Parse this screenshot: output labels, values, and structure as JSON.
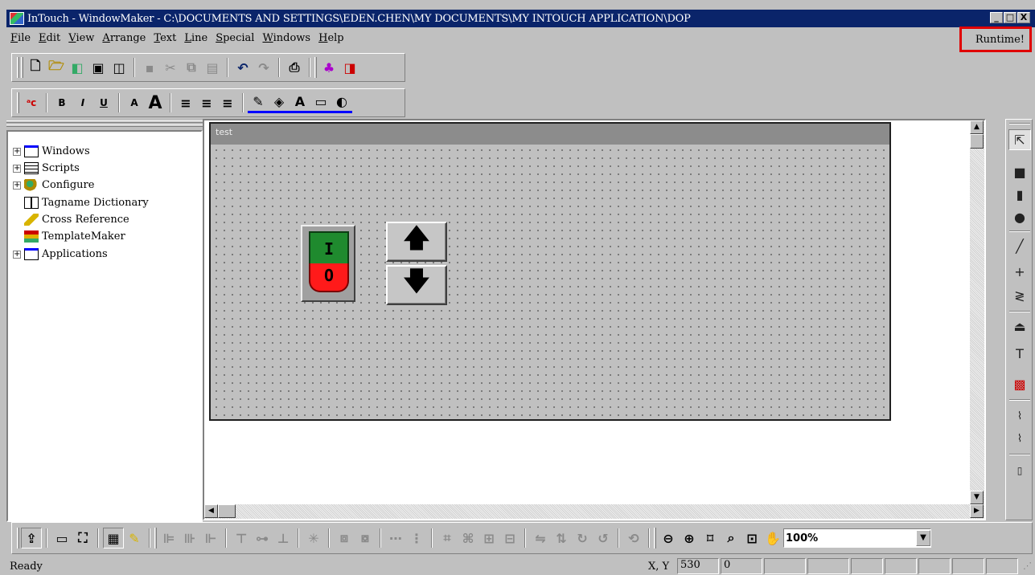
{
  "titlebar": {
    "title": "InTouch - WindowMaker - C:\\DOCUMENTS AND SETTINGS\\EDEN.CHEN\\MY DOCUMENTS\\MY INTOUCH APPLICATION\\DOP",
    "minimize": "_",
    "maximize": "□",
    "close": "X"
  },
  "menu": {
    "items": [
      "File",
      "Edit",
      "View",
      "Arrange",
      "Text",
      "Line",
      "Special",
      "Windows",
      "Help"
    ],
    "runtime": "Runtime!"
  },
  "tree": {
    "nodes": [
      {
        "label": "Windows",
        "expander": "+",
        "icon": "window-icon"
      },
      {
        "label": "Scripts",
        "expander": "+",
        "icon": "script-icon"
      },
      {
        "label": "Configure",
        "expander": "+",
        "icon": "configure-icon"
      },
      {
        "label": "Tagname Dictionary",
        "expander": "",
        "icon": "dictionary-icon"
      },
      {
        "label": "Cross Reference",
        "expander": "",
        "icon": "cross-reference-icon"
      },
      {
        "label": "TemplateMaker",
        "expander": "",
        "icon": "template-icon"
      },
      {
        "label": "Applications",
        "expander": "+",
        "icon": "applications-icon"
      }
    ]
  },
  "canvas": {
    "window_title": "test",
    "switch_on": "I",
    "switch_off": "O",
    "up_arrow": "🡅",
    "down_arrow": "🡇"
  },
  "bottom": {
    "zoom": "100%"
  },
  "status": {
    "text": "Ready",
    "xy_label": "X, Y",
    "x_value": "530",
    "y_value": "0"
  },
  "colors": {
    "title_bar": "#0a246a",
    "highlight": "#e00000",
    "switch_on": "#1f8a2e",
    "switch_off": "#ff1a1a"
  }
}
